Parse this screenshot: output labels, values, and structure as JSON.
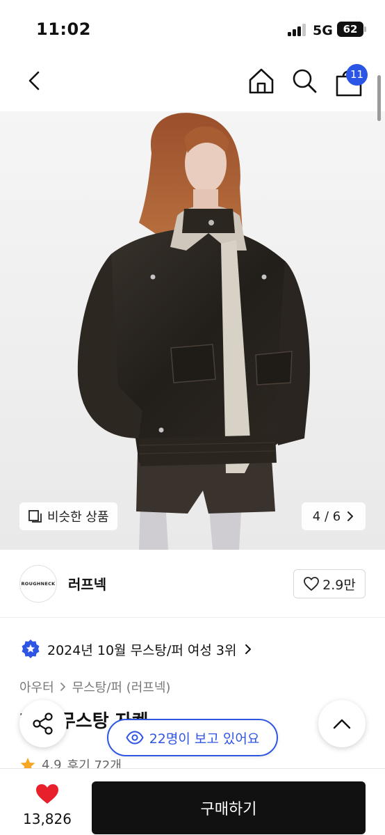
{
  "status_bar": {
    "time": "11:02",
    "network": "5G",
    "battery": "62"
  },
  "header": {
    "cart_count": "11",
    "icons": [
      "back-arrow-icon",
      "home-icon",
      "search-icon",
      "shopping-bag-icon"
    ]
  },
  "image": {
    "similar_label": "비슷한 상품",
    "page_indicator": "4 / 6"
  },
  "brand": {
    "logo_text": "ROUGHNECK",
    "name": "러프넥",
    "likes": "2.9만"
  },
  "ranking": {
    "text": "2024년 10월 무스탕/퍼 여성 3위"
  },
  "category": {
    "parent": "아우터",
    "child": "무스탕/퍼 (러프넥)"
  },
  "product": {
    "title": "레더 무스탕 자켓",
    "rating": "4.9",
    "reviews": "후기 72개"
  },
  "viewers": {
    "text": "22명이 보고 있어요"
  },
  "bottom_bar": {
    "wishlist_count": "13,826",
    "buy_label": "구매하기"
  },
  "colors": {
    "accent_blue": "#2f55e4",
    "heart_red": "#e8202b",
    "star_orange": "#f5a623",
    "buy_button": "#111111"
  }
}
